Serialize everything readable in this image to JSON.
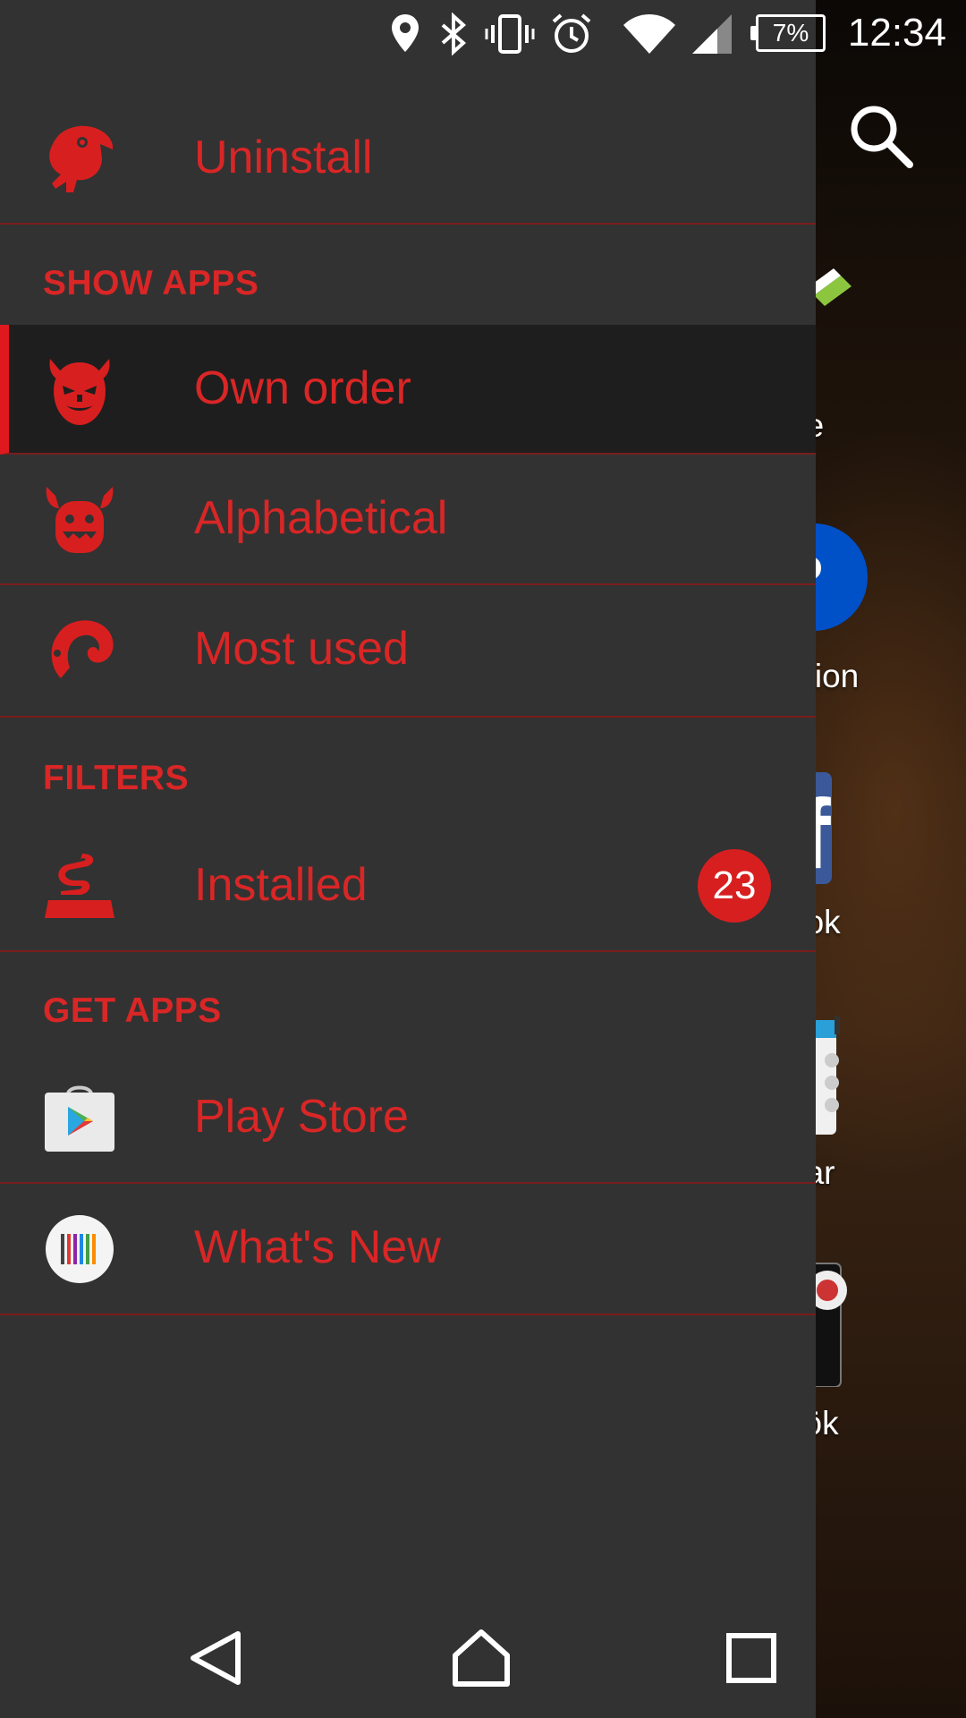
{
  "status_bar": {
    "time": "12:34",
    "battery": "7%",
    "icons": [
      "location-icon",
      "bluetooth-icon",
      "vibrate-icon",
      "alarm-icon",
      "wifi-icon",
      "signal-icon",
      "battery-icon"
    ]
  },
  "background": {
    "search_icon": "search-icon",
    "app_labels": [
      "ne",
      "ation",
      "ook",
      "dar",
      "zök"
    ]
  },
  "drawer": {
    "uninstall": {
      "label": "Uninstall",
      "icon": "monster-icon"
    },
    "section_show_apps": "SHOW APPS",
    "show_apps": [
      {
        "label": "Own order",
        "icon": "devil-face-icon",
        "selected": true
      },
      {
        "label": "Alphabetical",
        "icon": "horned-monster-icon",
        "selected": false
      },
      {
        "label": "Most used",
        "icon": "ram-horn-icon",
        "selected": false
      }
    ],
    "section_filters": "FILTERS",
    "installed": {
      "label": "Installed",
      "icon": "snake-icon",
      "count": "23"
    },
    "section_get_apps": "GET APPS",
    "get_apps": [
      {
        "label": "Play Store",
        "icon": "play-store-icon"
      },
      {
        "label": "What's New",
        "icon": "whats-new-icon"
      }
    ]
  },
  "navbar": {
    "icons": [
      "back-icon",
      "home-icon",
      "recents-icon"
    ]
  },
  "colors": {
    "accent": "#d92626",
    "drawer_bg": "#323232",
    "selected_bg": "#1e1e1e"
  }
}
